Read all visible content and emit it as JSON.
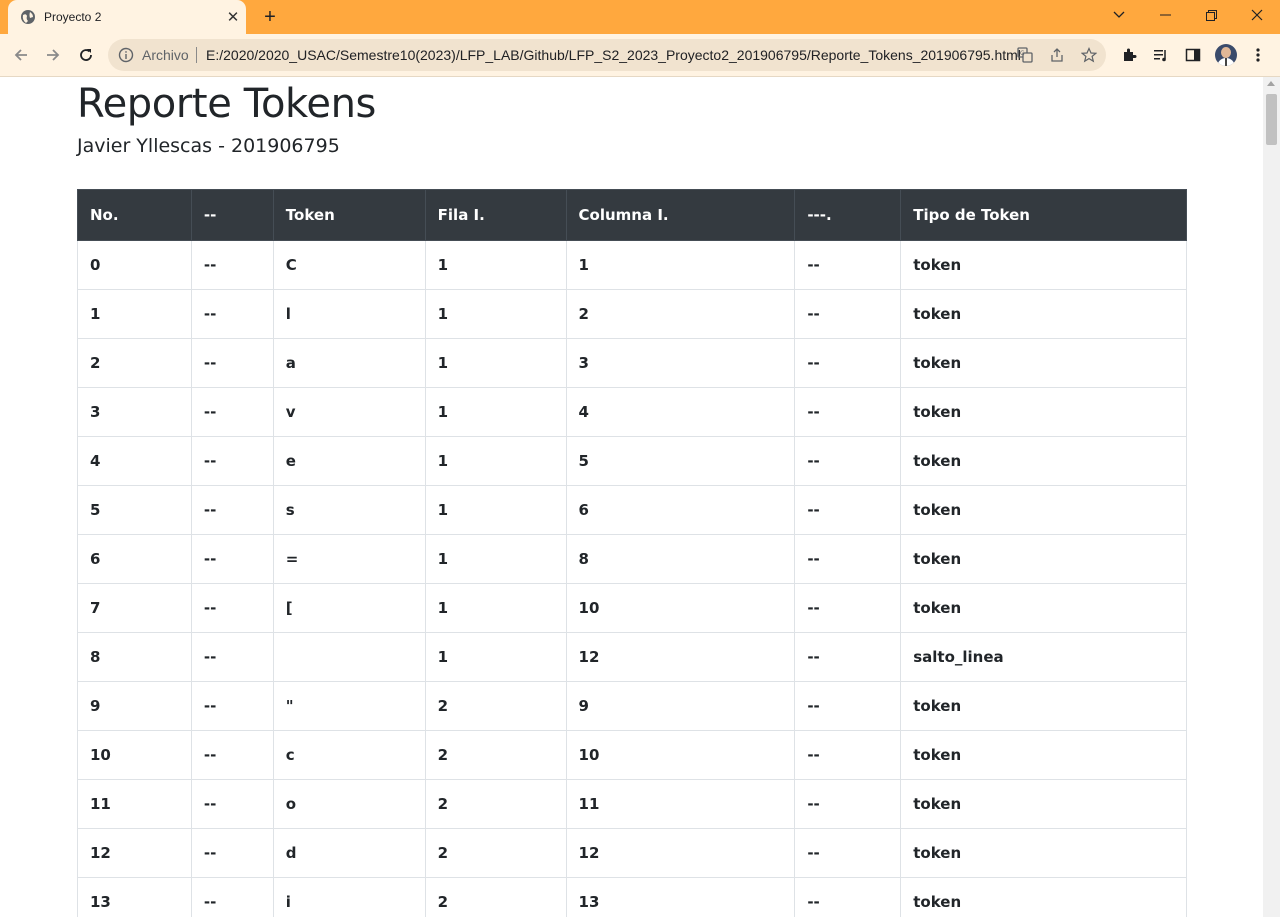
{
  "browser": {
    "tab_title": "Proyecto 2",
    "scheme_label": "Archivo",
    "url": "E:/2020/2020_USAC/Semestre10(2023)/LFP_LAB/Github/LFP_S2_2023_Proyecto2_201906795/Reporte_Tokens_201906795.html",
    "colors": {
      "frame": "#ffa83e",
      "toolbar": "#fff3e2",
      "omnibox": "#f1e3cf"
    }
  },
  "page": {
    "title": "Reporte Tokens",
    "subtitle": "Javier Yllescas - 201906795"
  },
  "table": {
    "headers": [
      "No.",
      "--",
      "Token",
      "Fila I.",
      "Columna I.",
      "---.",
      "Tipo de Token"
    ],
    "rows": [
      [
        "0",
        "--",
        "C",
        "1",
        "1",
        "--",
        "token"
      ],
      [
        "1",
        "--",
        "l",
        "1",
        "2",
        "--",
        "token"
      ],
      [
        "2",
        "--",
        "a",
        "1",
        "3",
        "--",
        "token"
      ],
      [
        "3",
        "--",
        "v",
        "1",
        "4",
        "--",
        "token"
      ],
      [
        "4",
        "--",
        "e",
        "1",
        "5",
        "--",
        "token"
      ],
      [
        "5",
        "--",
        "s",
        "1",
        "6",
        "--",
        "token"
      ],
      [
        "6",
        "--",
        "=",
        "1",
        "8",
        "--",
        "token"
      ],
      [
        "7",
        "--",
        "[",
        "1",
        "10",
        "--",
        "token"
      ],
      [
        "8",
        "--",
        "",
        "1",
        "12",
        "--",
        "salto_linea"
      ],
      [
        "9",
        "--",
        "\"",
        "2",
        "9",
        "--",
        "token"
      ],
      [
        "10",
        "--",
        "c",
        "2",
        "10",
        "--",
        "token"
      ],
      [
        "11",
        "--",
        "o",
        "2",
        "11",
        "--",
        "token"
      ],
      [
        "12",
        "--",
        "d",
        "2",
        "12",
        "--",
        "token"
      ],
      [
        "13",
        "--",
        "i",
        "2",
        "13",
        "--",
        "token"
      ]
    ],
    "colors": {
      "header_bg": "#343a40",
      "header_text": "#ffffff",
      "border": "#dee2e6"
    }
  }
}
